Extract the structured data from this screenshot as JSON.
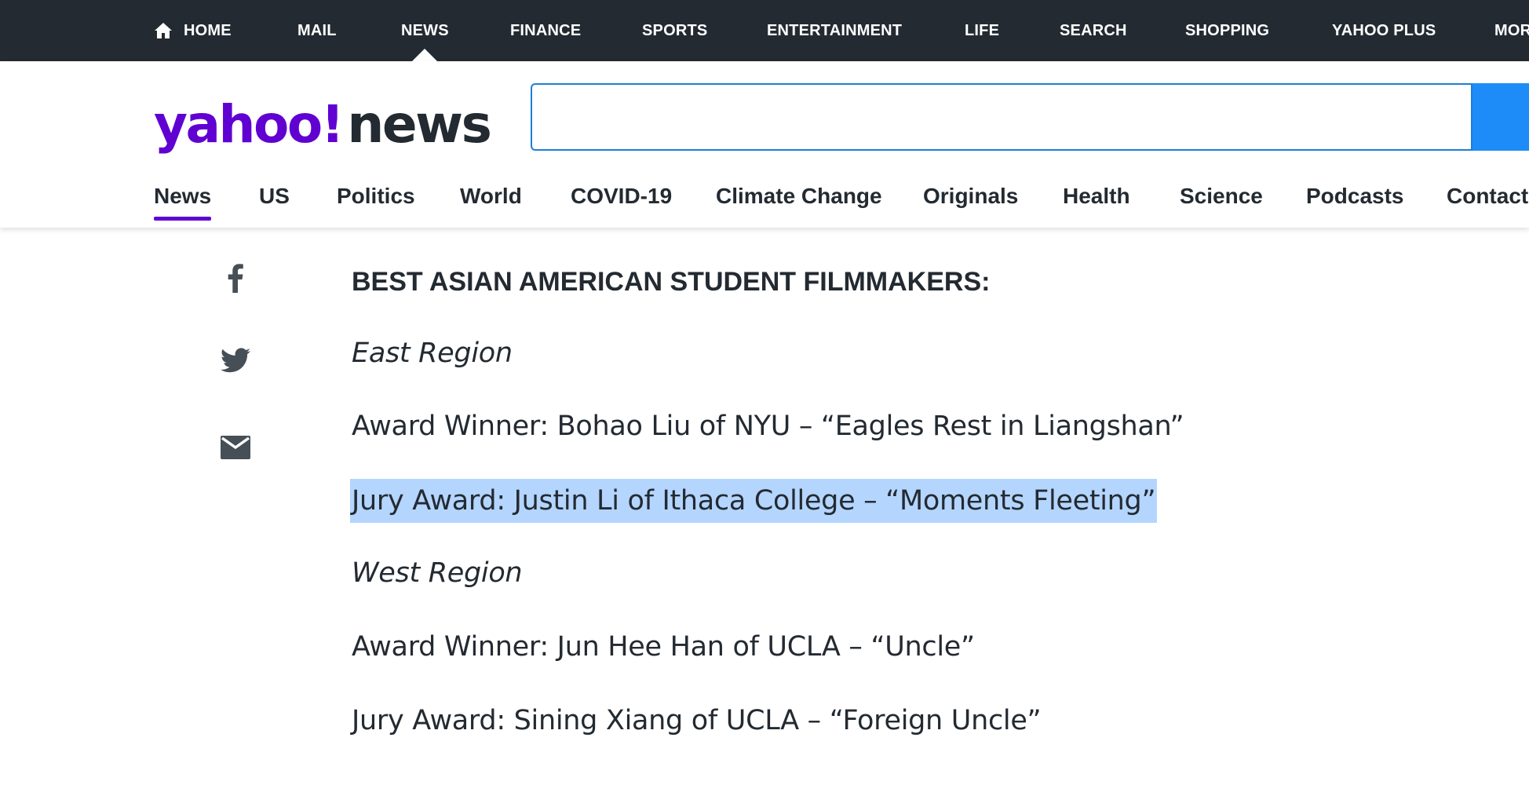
{
  "topnav": {
    "items": [
      {
        "label": "HOME"
      },
      {
        "label": "MAIL"
      },
      {
        "label": "NEWS"
      },
      {
        "label": "FINANCE"
      },
      {
        "label": "SPORTS"
      },
      {
        "label": "ENTERTAINMENT"
      },
      {
        "label": "LIFE"
      },
      {
        "label": "SEARCH"
      },
      {
        "label": "SHOPPING"
      },
      {
        "label": "YAHOO PLUS"
      },
      {
        "label": "MOR"
      }
    ],
    "active": "NEWS"
  },
  "logo": {
    "brand": "yahoo!",
    "section": "news"
  },
  "search": {
    "value": "",
    "placeholder": ""
  },
  "subnav": {
    "items": [
      {
        "label": "News"
      },
      {
        "label": "US"
      },
      {
        "label": "Politics"
      },
      {
        "label": "World"
      },
      {
        "label": "COVID-19"
      },
      {
        "label": "Climate Change"
      },
      {
        "label": "Originals"
      },
      {
        "label": "Health"
      },
      {
        "label": "Science"
      },
      {
        "label": "Podcasts"
      },
      {
        "label": "Contact"
      }
    ],
    "active": "News"
  },
  "share": [
    "facebook-icon",
    "twitter-icon",
    "mail-icon"
  ],
  "article": {
    "heading": "BEST ASIAN AMERICAN STUDENT FILMMAKERS:",
    "paragraphs": [
      {
        "text": "East Region"
      },
      {
        "text": "Award Winner: Bohao Liu of NYU – “Eagles Rest in Liangshan”"
      },
      {
        "text": "Jury Award: Justin Li of Ithaca College – “Moments Fleeting”"
      },
      {
        "text": "West Region"
      },
      {
        "text": "Award Winner: Jun Hee Han of UCLA – “Uncle”"
      },
      {
        "text": "Jury Award: Sining Xiang of UCLA – “Foreign Uncle”"
      }
    ]
  },
  "colors": {
    "topbar": "#232a31",
    "brand_purple": "#6001d2",
    "search_blue": "#1d8cf8",
    "selection": "#b4d5fe"
  }
}
